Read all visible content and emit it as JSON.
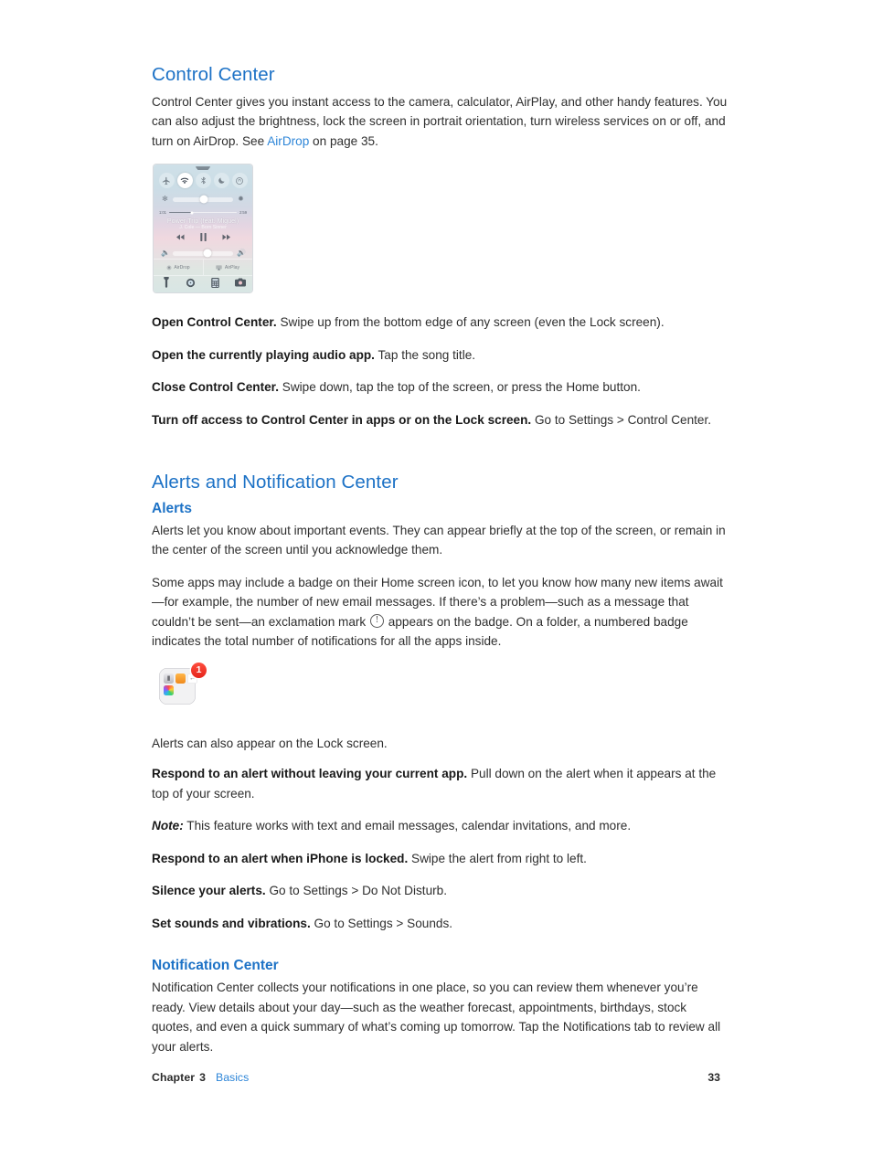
{
  "page": {
    "number": "33",
    "chapter_label": "Chapter",
    "chapter_number": "3",
    "chapter_title": "Basics"
  },
  "sections": {
    "control_center": {
      "heading": "Control Center",
      "intro_part1": "Control Center gives you instant access to the camera, calculator, AirPlay, and other handy features. You can also adjust the brightness, lock the screen in portrait orientation, turn wireless services on or off, and turn on AirDrop. See ",
      "intro_link": "AirDrop",
      "intro_part2": " on page 35.",
      "tasks": [
        {
          "lead": "Open Control Center.",
          "rest": " Swipe up from the bottom edge of any screen (even the Lock screen)."
        },
        {
          "lead": "Open the currently playing audio app.",
          "rest": " Tap the song title."
        },
        {
          "lead": "Close Control Center.",
          "rest": " Swipe down, tap the top of the screen, or press the Home button."
        },
        {
          "lead": "Turn off access to Control Center in apps or on the Lock screen.",
          "rest": " Go to Settings > Control Center."
        }
      ]
    },
    "alerts_notification_center": {
      "heading": "Alerts and Notification Center",
      "alerts": {
        "heading": "Alerts",
        "para1": "Alerts let you know about important events. They can appear briefly at the top of the screen, or remain in the center of the screen until you acknowledge them.",
        "para2_part1": "Some apps may include a badge on their Home screen icon, to let you know how many new items await—for example, the number of new email messages. If there’s a problem—such as a message that couldn’t be sent—an exclamation mark ",
        "para2_part2": " appears on the badge. On a folder, a numbered badge indicates the total number of notifications for all the apps inside.",
        "para3": "Alerts can also appear on the Lock screen.",
        "tasks": [
          {
            "lead": "Respond to an alert without leaving your current app.",
            "rest": " Pull down on the alert when it appears at the top of your screen."
          },
          {
            "lead": "Respond to an alert when iPhone is locked.",
            "rest": " Swipe the alert from right to left."
          },
          {
            "lead": "Silence your alerts.",
            "rest": " Go to Settings > Do Not Disturb."
          },
          {
            "lead": "Set sounds and vibrations.",
            "rest": " Go to Settings > Sounds."
          }
        ],
        "note_lead": "Note:",
        "note_rest": "  This feature works with text and email messages, calendar invitations, and more."
      },
      "notification_center": {
        "heading": "Notification Center",
        "para1": "Notification Center collects your notifications in one place, so you can review them whenever you’re ready. View details about your day—such as the weather forecast, appointments, birthdays, stock quotes, and even a quick summary of what’s coming up tomorrow. Tap the Notifications tab to review all your alerts."
      }
    }
  },
  "figures": {
    "control_center_screenshot": {
      "caption_alt": "iOS Control Center",
      "toggles": [
        {
          "name": "airplane-mode",
          "active": "false"
        },
        {
          "name": "wifi",
          "active": "true"
        },
        {
          "name": "bluetooth",
          "active": "false"
        },
        {
          "name": "do-not-disturb",
          "active": "false"
        },
        {
          "name": "rotation-lock",
          "active": "false"
        }
      ],
      "now_playing": {
        "elapsed": "1:01",
        "remaining": "2:59",
        "song": "Power Trip (feat. Miguel)",
        "artist": "J. Cole — Born Sinner"
      },
      "share_buttons": [
        {
          "label": "AirDrop"
        },
        {
          "label": "AirPlay"
        }
      ],
      "app_shortcuts": [
        "flashlight",
        "timer",
        "calculator",
        "camera"
      ]
    },
    "folder_badge": {
      "caption_alt": "Home screen folder with notification badge",
      "badge_count": "1"
    }
  },
  "colors": {
    "heading_blue": "#1d72c6",
    "link_blue": "#2e86d8",
    "body_text": "#2e2e2e",
    "badge_red": "#e5231a"
  }
}
